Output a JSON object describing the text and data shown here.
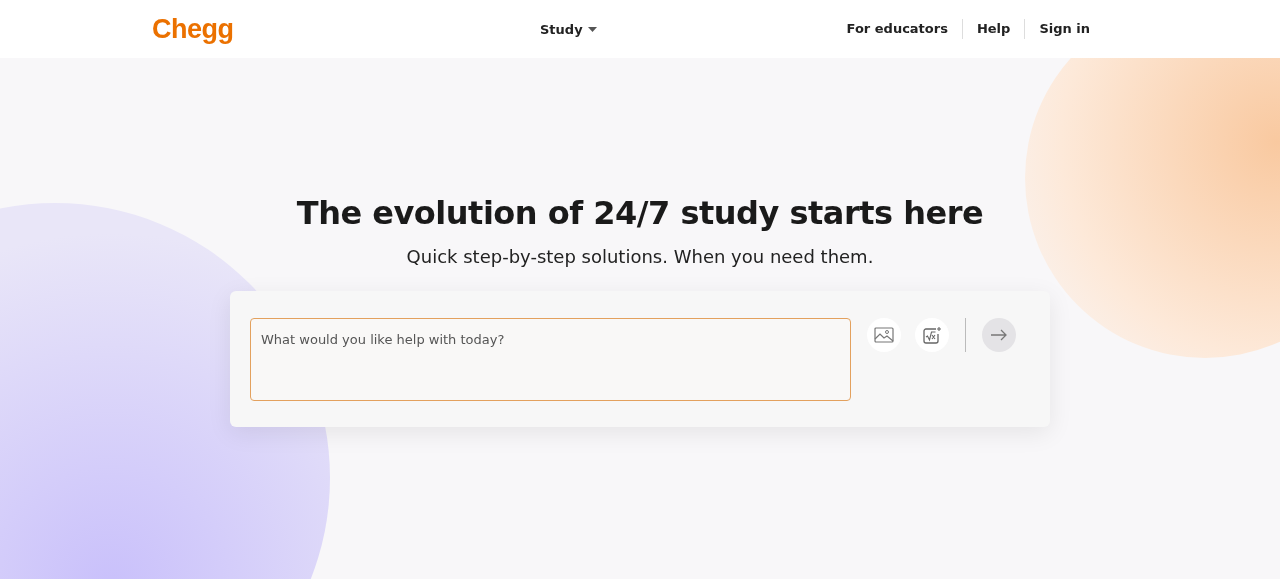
{
  "header": {
    "logo": "Chegg",
    "nav": [
      {
        "label": "Study",
        "dropdown": true
      }
    ],
    "links": [
      "For educators",
      "Help",
      "Sign in"
    ]
  },
  "hero": {
    "title": "The evolution of 24/7 study starts here",
    "subtitle": "Quick step-by-step solutions. When you need them.",
    "search": {
      "placeholder": "What would you like help with today?"
    }
  }
}
